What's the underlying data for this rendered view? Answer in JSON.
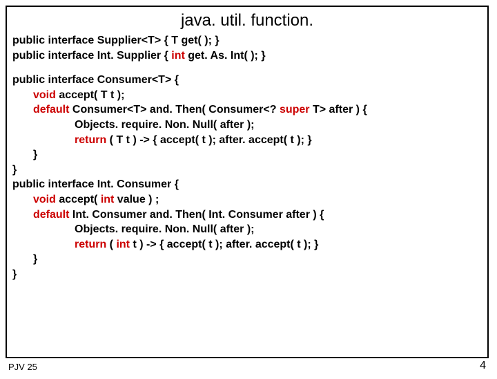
{
  "title": "java. util. function.",
  "l1": {
    "a": "public  interface  Supplier<T>  {  T  get( );  }"
  },
  "l2": {
    "a": "public  interface  Int. Supplier  { ",
    "b": "int",
    "c": "    get. As. Int( ); }"
  },
  "l3": {
    "a": "public  interface  Consumer<T>  {"
  },
  "l4": {
    "a": "void",
    "b": " accept( T t );"
  },
  "l5": {
    "a": "default",
    "b": "  Consumer<T>  and. Then( Consumer<?  ",
    "c": "super",
    "d": " T>  after ) {"
  },
  "l6": {
    "a": "Objects. require. Non. Null( after );"
  },
  "l7": {
    "a": "return",
    "b": " ( T t )  ->  {  accept( t );  after. accept( t ); }"
  },
  "l8": {
    "a": "}"
  },
  "l9": {
    "a": "}"
  },
  "l10": {
    "a": "public  interface  Int. Consumer  {"
  },
  "l11": {
    "a": "void",
    "b": " accept( ",
    "c": "int",
    "d": " value ) ;"
  },
  "l12": {
    "a": "default",
    "b": "  Int. Consumer  and. Then( Int. Consumer after ) {"
  },
  "l13": {
    "a": "Objects. require. Non. Null( after );"
  },
  "l14": {
    "a": "return",
    "b": " ( ",
    "c": "int",
    "d": " t )  ->  {  accept( t );  after. accept( t ); }"
  },
  "l15": {
    "a": "}"
  },
  "l16": {
    "a": "}"
  },
  "footer": {
    "left": "PJV 25",
    "right": "4"
  }
}
